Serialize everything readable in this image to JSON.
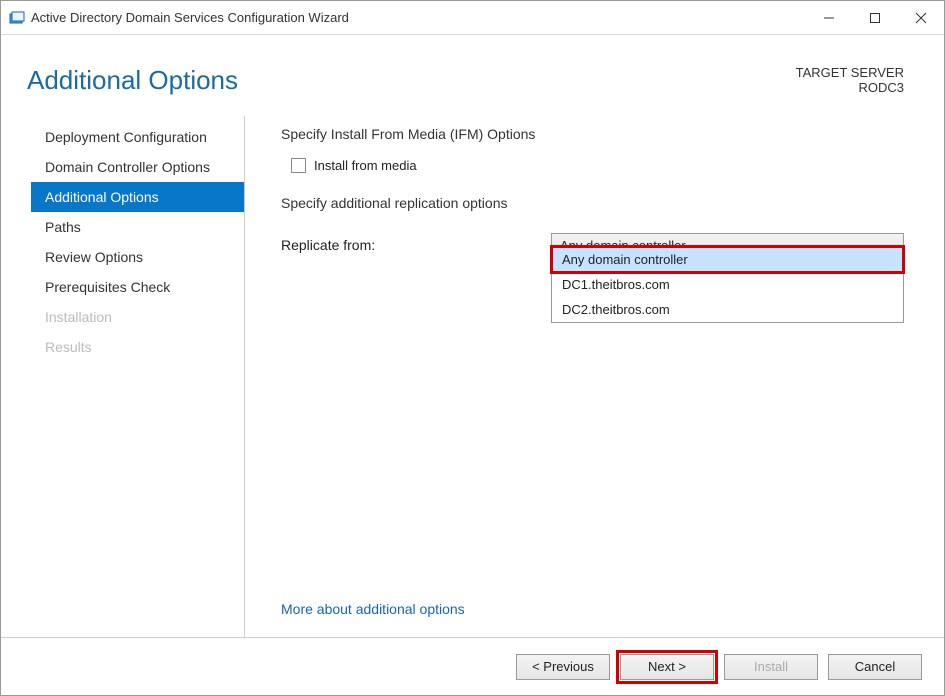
{
  "window": {
    "title": "Active Directory Domain Services Configuration Wizard"
  },
  "header": {
    "page_title": "Additional Options",
    "target_label": "TARGET SERVER",
    "target_name": "RODC3"
  },
  "sidebar": {
    "items": [
      {
        "label": "Deployment Configuration",
        "selected": false,
        "disabled": false
      },
      {
        "label": "Domain Controller Options",
        "selected": false,
        "disabled": false
      },
      {
        "label": "Additional Options",
        "selected": true,
        "disabled": false
      },
      {
        "label": "Paths",
        "selected": false,
        "disabled": false
      },
      {
        "label": "Review Options",
        "selected": false,
        "disabled": false
      },
      {
        "label": "Prerequisites Check",
        "selected": false,
        "disabled": false
      },
      {
        "label": "Installation",
        "selected": false,
        "disabled": true
      },
      {
        "label": "Results",
        "selected": false,
        "disabled": true
      }
    ]
  },
  "content": {
    "ifm_heading": "Specify Install From Media (IFM) Options",
    "ifm_checkbox_label": "Install from media",
    "ifm_checked": false,
    "replication_heading": "Specify additional replication options",
    "replicate_from_label": "Replicate from:",
    "replicate_from_value": "Any domain controller",
    "dropdown_items": [
      {
        "label": "Any domain controller",
        "highlighted": true
      },
      {
        "label": "DC1.theitbros.com",
        "highlighted": false
      },
      {
        "label": "DC2.theitbros.com",
        "highlighted": false
      }
    ],
    "help_link": "More about additional options"
  },
  "footer": {
    "previous": "< Previous",
    "next": "Next >",
    "install": "Install",
    "cancel": "Cancel"
  }
}
